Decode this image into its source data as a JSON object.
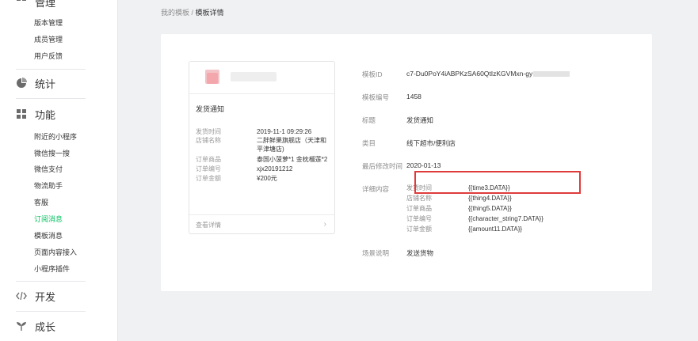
{
  "sidebar": {
    "manage_title": "管理",
    "manage_items": [
      "版本管理",
      "成员管理",
      "用户反馈"
    ],
    "stats_title": "统计",
    "func_title": "功能",
    "func_items": [
      "附近的小程序",
      "微信搜一搜",
      "微信支付",
      "物流助手",
      "客服",
      "订阅消息",
      "模板消息",
      "页面内容接入",
      "小程序插件"
    ],
    "active_item": "订阅消息",
    "dev_title": "开发",
    "growth_title": "成长"
  },
  "breadcrumb": {
    "parent": "我的模板",
    "sep": " / ",
    "current": "模板详情"
  },
  "preview": {
    "notice_title": "发货通知",
    "rows": [
      {
        "label": "发货时间",
        "value": "2019-11-1 09:29:26"
      },
      {
        "label": "店铺名称",
        "value": "二胖鲜果旗舰店（天津和"
      },
      {
        "label": "",
        "value": "平津塘店)"
      },
      {
        "label": "订单商品",
        "value": "泰国小菠萝*1 金枕榴莲*2"
      },
      {
        "label": "订单编号",
        "value": "xjx20191212"
      },
      {
        "label": "订单金额",
        "value": "¥200元"
      }
    ],
    "footer_link": "查看详情",
    "chevron": "›"
  },
  "info": {
    "template_id_label": "模板ID",
    "template_id_value": "c7-Du0PoY4iABPKzSA60QtIzKGVMxn-gy",
    "template_no_label": "模板编号",
    "template_no_value": "1458",
    "title_label": "标题",
    "title_value": "发货通知",
    "category_label": "类目",
    "category_value": "线下超市/便利店",
    "modified_label": "最后修改时间",
    "modified_value": "2020-01-13",
    "detail_label": "详细内容",
    "details": [
      {
        "label": "发货时间",
        "value": "{{time3.DATA}}"
      },
      {
        "label": "店铺名称",
        "value": "{{thing4.DATA}}"
      },
      {
        "label": "订单商品",
        "value": "{{thing5.DATA}}"
      },
      {
        "label": "订单编号",
        "value": "{{character_string7.DATA}}"
      },
      {
        "label": "订单金额",
        "value": "{{amount11.DATA}}"
      }
    ],
    "scene_label": "场景说明",
    "scene_value": "发送货物"
  },
  "colors": {
    "accent": "#07c160",
    "highlight_box": "#e03b3b"
  }
}
